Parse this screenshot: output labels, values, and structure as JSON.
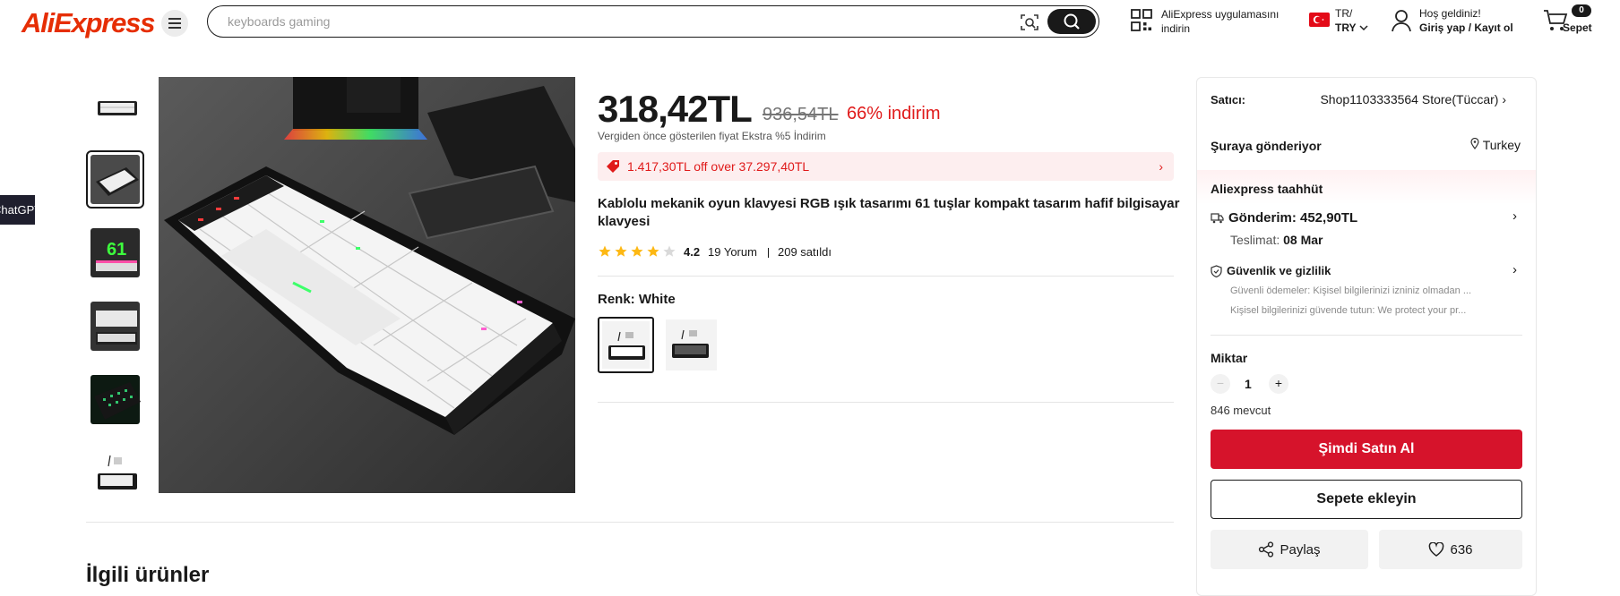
{
  "header": {
    "logo": "AliExpress",
    "search_placeholder": "keyboards gaming",
    "app_promo": "AliExpress uygulamasını indirin",
    "lang": "TR/",
    "currency": "TRY",
    "welcome": "Hoş geldiniz!",
    "signin": "Giriş yap / Kayıt ol",
    "cart_count": "0",
    "cart_label": "Sepet"
  },
  "side_tab": "ChatGPT",
  "product": {
    "price": "318,42TL",
    "old_price": "936,54TL",
    "discount": "66% indirim",
    "tax_note": "Vergiden önce gösterilen fiyat Ekstra %5 İndirim",
    "coupon": "1.417,30TL off over 37.297,40TL",
    "title": "Kablolu mekanik oyun klavyesi RGB ışık tasarımı 61 tuşlar kompakt tasarım hafif bilgisayar klavyesi",
    "rating": "4.2",
    "rating_value": 4.2,
    "reviews": "19 Yorum",
    "sold": "209 satıldı",
    "color_label": "Renk: White",
    "thumbnail_count": 6
  },
  "related_title": "İlgili ürünler",
  "panel": {
    "seller_label": "Satıcı:",
    "seller_name": "Shop1103333564 Store(Tüccar)",
    "ship_to_label": "Şuraya gönderiyor",
    "ship_to_value": "Turkey",
    "commitment": "Aliexpress taahhüt",
    "shipping": "Gönderim: 452,90TL",
    "delivery_label": "Teslimat:",
    "delivery_date": "08 Mar",
    "security_title": "Güvenlik ve gizlilik",
    "security_line1": "Güvenli ödemeler: Kişisel bilgilerinizi izniniz olmadan ...",
    "security_line2": "Kişisel bilgilerinizi güvende tutun: We protect your pr...",
    "qty_label": "Miktar",
    "qty_value": "1",
    "stock": "846 mevcut",
    "buy_now": "Şimdi Satın Al",
    "add_to_cart": "Sepete ekleyin",
    "share": "Paylaş",
    "wishlist_count": "636"
  },
  "colors": {
    "accent_red": "#e01a1a",
    "buy_button": "#d6132b",
    "star": "#fdb813"
  }
}
